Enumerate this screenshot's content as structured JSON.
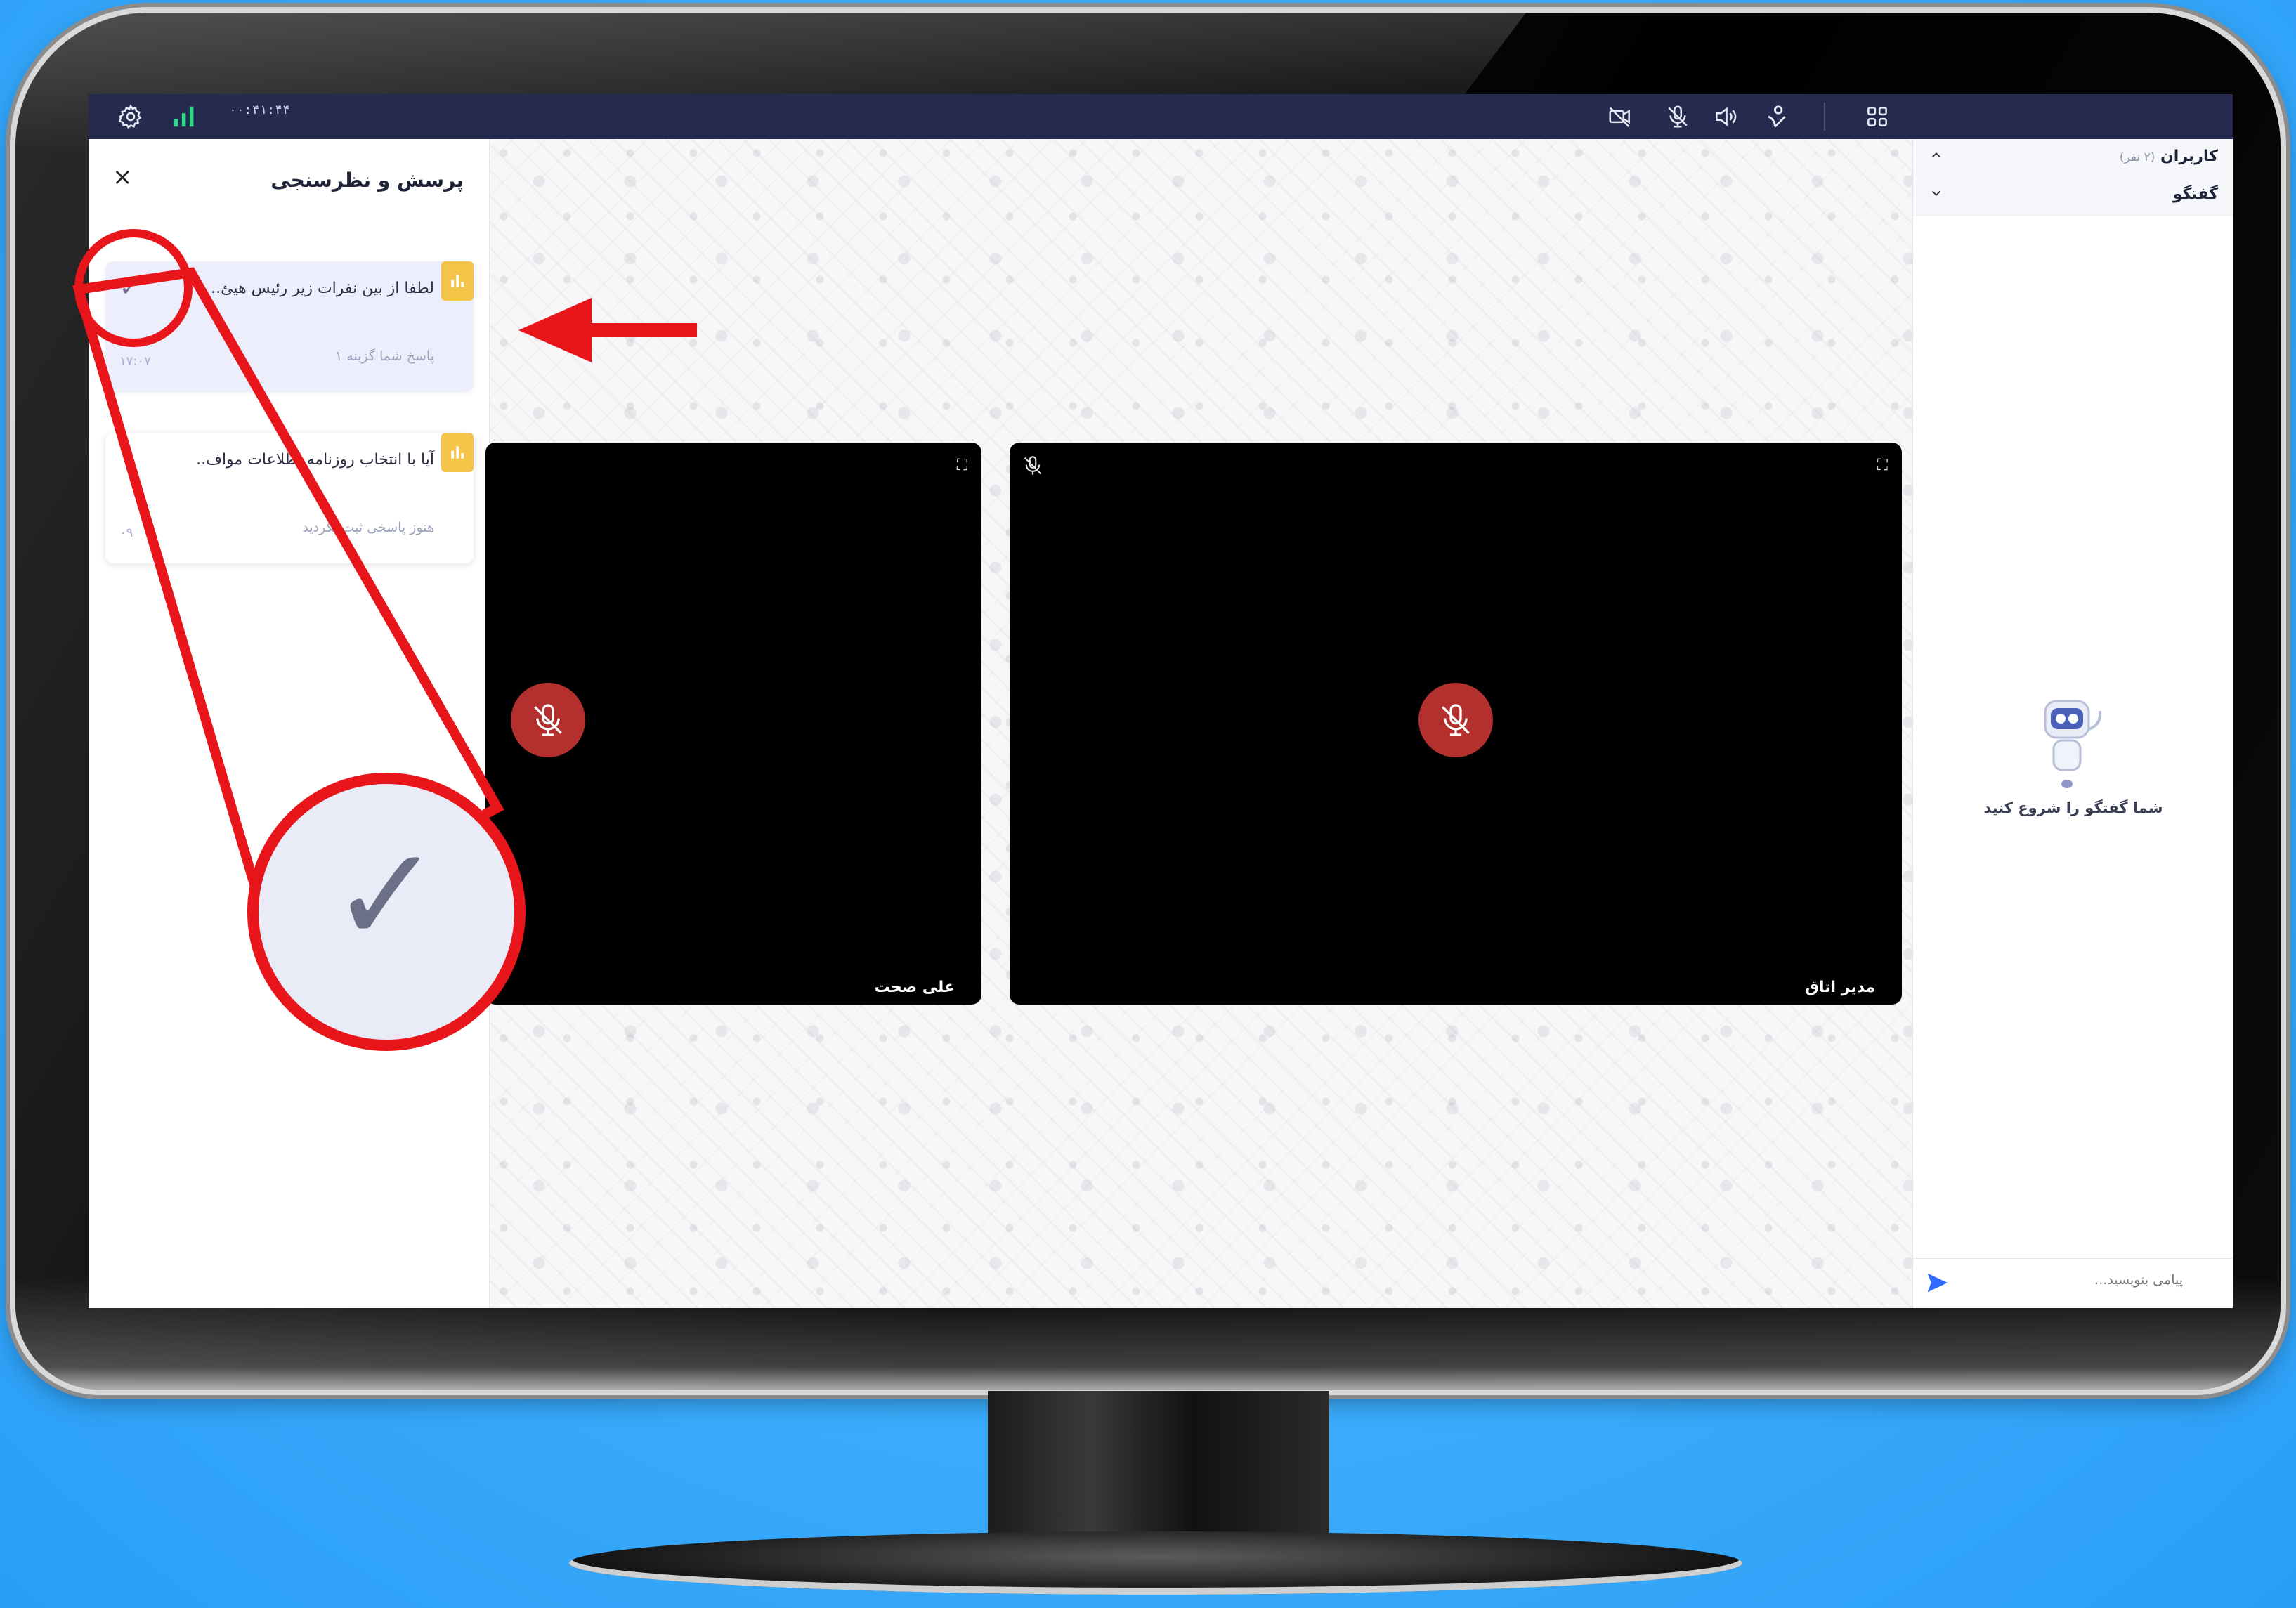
{
  "topbar": {
    "timer": "۰۰:۴۱:۴۴",
    "icons": [
      "gear-icon",
      "signal-bars-icon",
      "camera-off-icon",
      "mic-off-icon",
      "speaker-icon",
      "raise-hand-icon",
      "layout-grid-icon"
    ],
    "signal_color": "#2fd98a"
  },
  "poll_panel": {
    "title": "پرسش و نظرسنجی",
    "close_symbol": "×",
    "cards": [
      {
        "question": "لطفا از بین نفرات زیر رئیس هیئ..",
        "status": "پاسخ شما گزینه ۱",
        "time": "۱۷:۰۷",
        "check": "✓"
      },
      {
        "question": "آیا با انتخاب روزنامه اطلاعات مواف..",
        "status": "هنوز پاسخی ثبت نکردید",
        "time": "۰۹"
      }
    ]
  },
  "video_tiles": [
    {
      "name": "علی صحت",
      "expand": "⛶"
    },
    {
      "name": "مدیر اتاق",
      "expand": "⛶"
    }
  ],
  "chat_panel": {
    "users_label": "کاربران",
    "users_count": "(۲ نفر)",
    "chat_label": "گفتگو",
    "empty_text": "شما گفتگو را شروع کنید",
    "input_placeholder": "پیامی بنویسید..."
  },
  "annotation": {
    "zoom_check": "✓",
    "color": "#e8161b"
  }
}
